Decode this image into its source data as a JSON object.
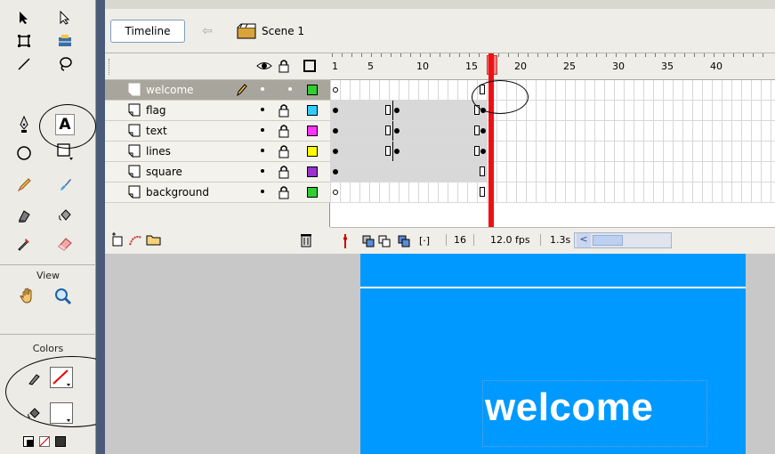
{
  "toolbar": {
    "timeline_label": "Timeline",
    "scene_label": "Scene 1"
  },
  "tools_panel": {
    "view_label": "View",
    "colors_label": "Colors",
    "text_tool_glyph": "A"
  },
  "layers": [
    {
      "name": "welcome",
      "color": "#33cc33",
      "selected": true
    },
    {
      "name": "flag",
      "color": "#33ccff",
      "selected": false
    },
    {
      "name": "text",
      "color": "#ff33ff",
      "selected": false
    },
    {
      "name": "lines",
      "color": "#ffff00",
      "selected": false
    },
    {
      "name": "square",
      "color": "#9933cc",
      "selected": false
    },
    {
      "name": "background",
      "color": "#33cc33",
      "selected": false
    }
  ],
  "ruler": {
    "labels": [
      "1",
      "5",
      "10",
      "15",
      "20",
      "25",
      "30",
      "35",
      "40"
    ]
  },
  "timeline_footer": {
    "current_frame": "16",
    "fps": "12.0 fps",
    "time": "1.3s"
  },
  "stage": {
    "text": "welcome",
    "background": "#0099ff"
  },
  "icons": [
    "arrow-icon",
    "subselect-icon",
    "free-transform-icon",
    "fill-transform-icon",
    "line-icon",
    "lasso-icon",
    "pen-icon",
    "text-icon",
    "oval-icon",
    "rectangle-icon",
    "pencil-icon",
    "brush-icon",
    "ink-bottle-icon",
    "paint-bucket-icon",
    "eyedropper-icon",
    "eraser-icon",
    "hand-icon",
    "zoom-icon",
    "stroke-color-icon",
    "fill-color-icon"
  ]
}
